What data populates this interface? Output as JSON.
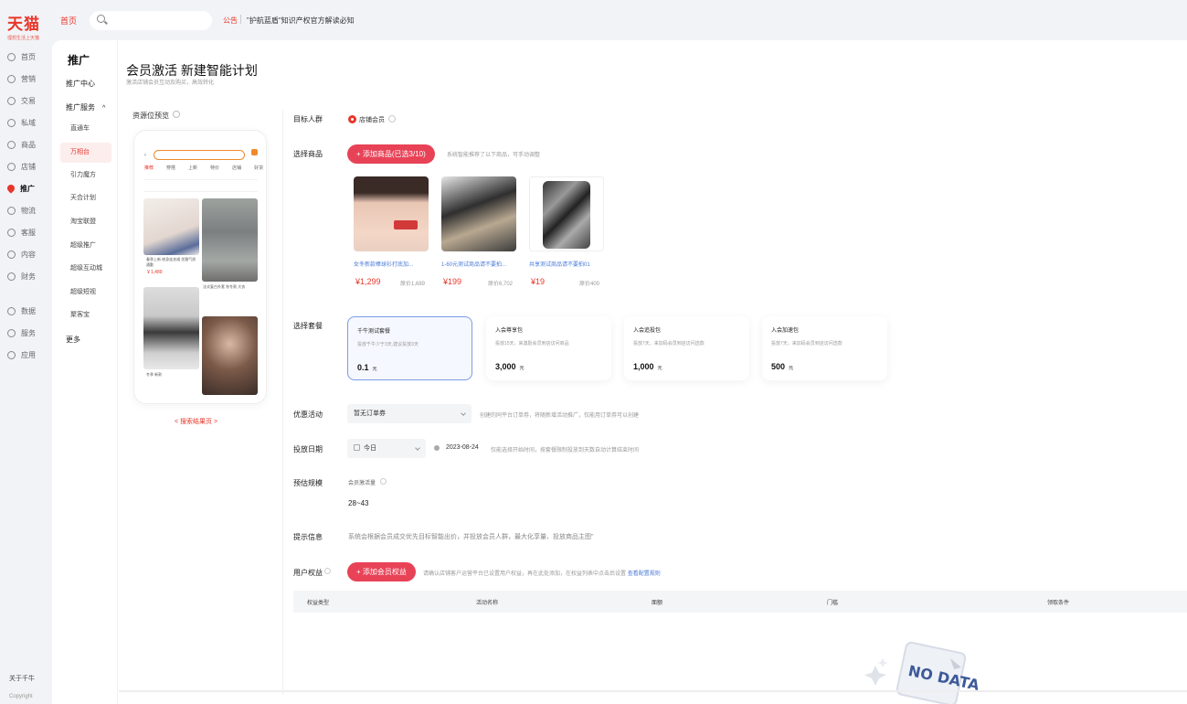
{
  "topbar": {
    "logo": "天猫",
    "logo_sub": "理想生活上天猫",
    "home": "首页",
    "search_placeholder": "",
    "notice_tag": "公告",
    "notice_text": "\"护航蓝盾\"知识产权官方解读必知"
  },
  "rail": {
    "items": [
      "首页",
      "营销",
      "交易",
      "私域",
      "商品",
      "店铺",
      "推广",
      "物流",
      "客服",
      "内容",
      "财务",
      "数据",
      "服务",
      "应用"
    ],
    "about": "关于千牛",
    "copyright": "Copyright"
  },
  "submenu": {
    "title": "推广",
    "center": "推广中心",
    "service": "推广服务",
    "children": [
      "直通车",
      "万相台",
      "引力魔方",
      "天合计划",
      "淘宝联盟",
      "超级推广",
      "超级互动城",
      "超级短视",
      "聚客宝"
    ],
    "more": "更多"
  },
  "page": {
    "title": "会员激活  新建智能计划",
    "subtitle": "激活店铺会员互动及购买，高效转化"
  },
  "preview": {
    "label": "资源位预览",
    "tabs": [
      "推荐",
      "穿搭",
      "上新",
      "特价",
      "店铺",
      "好货"
    ],
    "tile1_text": "春季上新 修身连衣裙 优雅气质 通勤",
    "tile1_price": "￥1,489",
    "tile3_text": "法式复古外套 秋冬款 大衣",
    "tile4_text": "冬季 新款",
    "pager": "< 搜索结果页 >"
  },
  "form": {
    "audience_label": "目标人群",
    "audience_option": "店铺会员",
    "goods_label": "选择商品",
    "goods_button": "+ 添加商品(已选3/10)",
    "goods_hint": "系统智能推荐了以下商品，可手动调整",
    "products": [
      {
        "name": "女冬新款棒球衫打底加...",
        "price": "¥1,299",
        "orig": "原价1,689"
      },
      {
        "name": "1-60元测试商品请不要拍...",
        "price": "¥199",
        "orig": "原价6,702"
      },
      {
        "name": "共享测试商品请不要拍01",
        "price": "¥19",
        "orig": "原价400"
      }
    ],
    "package_label": "选择套餐",
    "packages": [
      {
        "name": "千牛测试套餐",
        "desc": "投放千牛少于3天,建议投放3天",
        "price": "0.1",
        "unit": "元"
      },
      {
        "name": "入会尊享包",
        "desc": "投放15天，来激励会员到店访问商品",
        "price": "3,000",
        "unit": "元"
      },
      {
        "name": "入会追投包",
        "desc": "投放7天，来加码会员到店访问选款",
        "price": "1,000",
        "unit": "元"
      },
      {
        "name": "入会加速包",
        "desc": "投放7天，来加码会员到店访问选款",
        "price": "500",
        "unit": "元"
      }
    ],
    "promo_label": "优惠活动",
    "promo_value": "暂无订单券",
    "promo_hint": "创建的同平台订单券，将随新增活动推广，仅能用订单券可以创建",
    "date_label": "投放日期",
    "date_select": "今日",
    "date_value": "2023-08-24",
    "date_hint": "仅能选择开始时间，按套餐限制投放到天数自动计算结束时间",
    "estimate_label": "预估规模",
    "estimate_sub": "会员激活量",
    "estimate_value": "28~43",
    "tip_label": "提示信息",
    "tip_text": "系统会根据会员成交优先目标智能出价，并投放会员人群，最大化享量、投放商品主图\"",
    "rights_label": "用户权益",
    "rights_button": "+ 添加会员权益",
    "rights_hint": "请确认店铺客户运营平台已设置用户权益，再在此处添加，在权益列表中点击后设置",
    "rights_link": "查看配置规则",
    "table_headers": [
      "权益类型",
      "活动名称",
      "面额",
      "门槛",
      "领取条件"
    ],
    "nodata": "NO DATA"
  }
}
